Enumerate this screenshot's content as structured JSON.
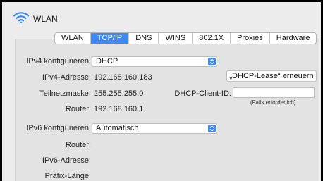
{
  "window": {
    "title": "WLAN"
  },
  "tabs": [
    {
      "label": "WLAN",
      "active": false
    },
    {
      "label": "TCP/IP",
      "active": true
    },
    {
      "label": "DNS",
      "active": false
    },
    {
      "label": "WINS",
      "active": false
    },
    {
      "label": "802.1X",
      "active": false
    },
    {
      "label": "Proxies",
      "active": false
    },
    {
      "label": "Hardware",
      "active": false
    }
  ],
  "ipv4": {
    "configure_label": "IPv4 konfigurieren:",
    "configure_value": "DHCP",
    "address_label": "IPv4-Adresse:",
    "address_value": "192.168.160.183",
    "subnet_label": "Teilnetzmaske:",
    "subnet_value": "255.255.255.0",
    "router_label": "Router:",
    "router_value": "192.168.160.1",
    "renew_button": "„DHCP-Lease“ erneuern",
    "client_id_label": "DHCP-Client-ID:",
    "client_id_value": "",
    "client_id_hint": "(Falls erforderlich)"
  },
  "ipv6": {
    "configure_label": "IPv6 konfigurieren:",
    "configure_value": "Automatisch",
    "router_label": "Router:",
    "address_label": "IPv6-Adresse:",
    "prefix_label": "Präfix-Länge:"
  },
  "colors": {
    "accent": "#3d8af7",
    "window_bg": "#ececec",
    "panel_bg": "#e3e3e3"
  }
}
